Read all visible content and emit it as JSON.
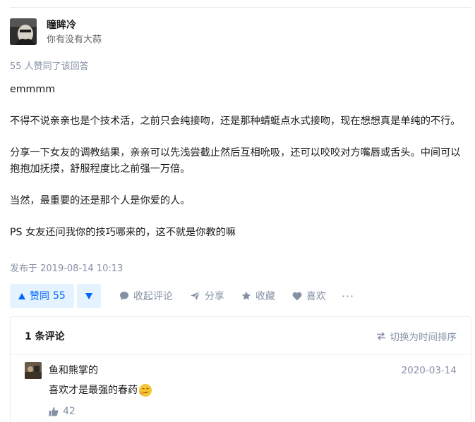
{
  "author": {
    "name": "瞳眸冷",
    "bio": "你有没有大蒜"
  },
  "vote_summary": "55 人赞同了该回答",
  "content": {
    "paragraphs": [
      "emmmm",
      "不得不说亲亲也是个技术活，之前只会纯接吻，还是那种蜻蜓点水式接吻，现在想想真是单纯的不行。",
      "分享一下女友的调教结果，亲亲可以先浅尝截止然后互相吮吸，还可以咬咬对方嘴唇或舌头。中间可以抱抱加抚摸，舒服程度比之前强一万倍。",
      "当然，最重要的还是那个人是你爱的人。",
      "PS 女友还问我你的技巧哪来的，这不就是你教的嘛"
    ]
  },
  "published": "发布于 2019-08-14 10:13",
  "actions": {
    "vote_up_label": "赞同",
    "vote_up_count": "55",
    "comment_label": "收起评论",
    "share_label": "分享",
    "collect_label": "收藏",
    "like_label": "喜欢",
    "more_label": "···"
  },
  "comments": {
    "count_label": "1 条评论",
    "sort_label": "切换为时间排序",
    "items": [
      {
        "user": "鱼和熊掌的",
        "date": "2020-03-14",
        "text": "喜欢才是最强的春药",
        "likes": "42"
      }
    ]
  },
  "colors": {
    "accent": "#0066ff",
    "accent_bg": "#e5f2ff",
    "muted": "#8590a6"
  }
}
